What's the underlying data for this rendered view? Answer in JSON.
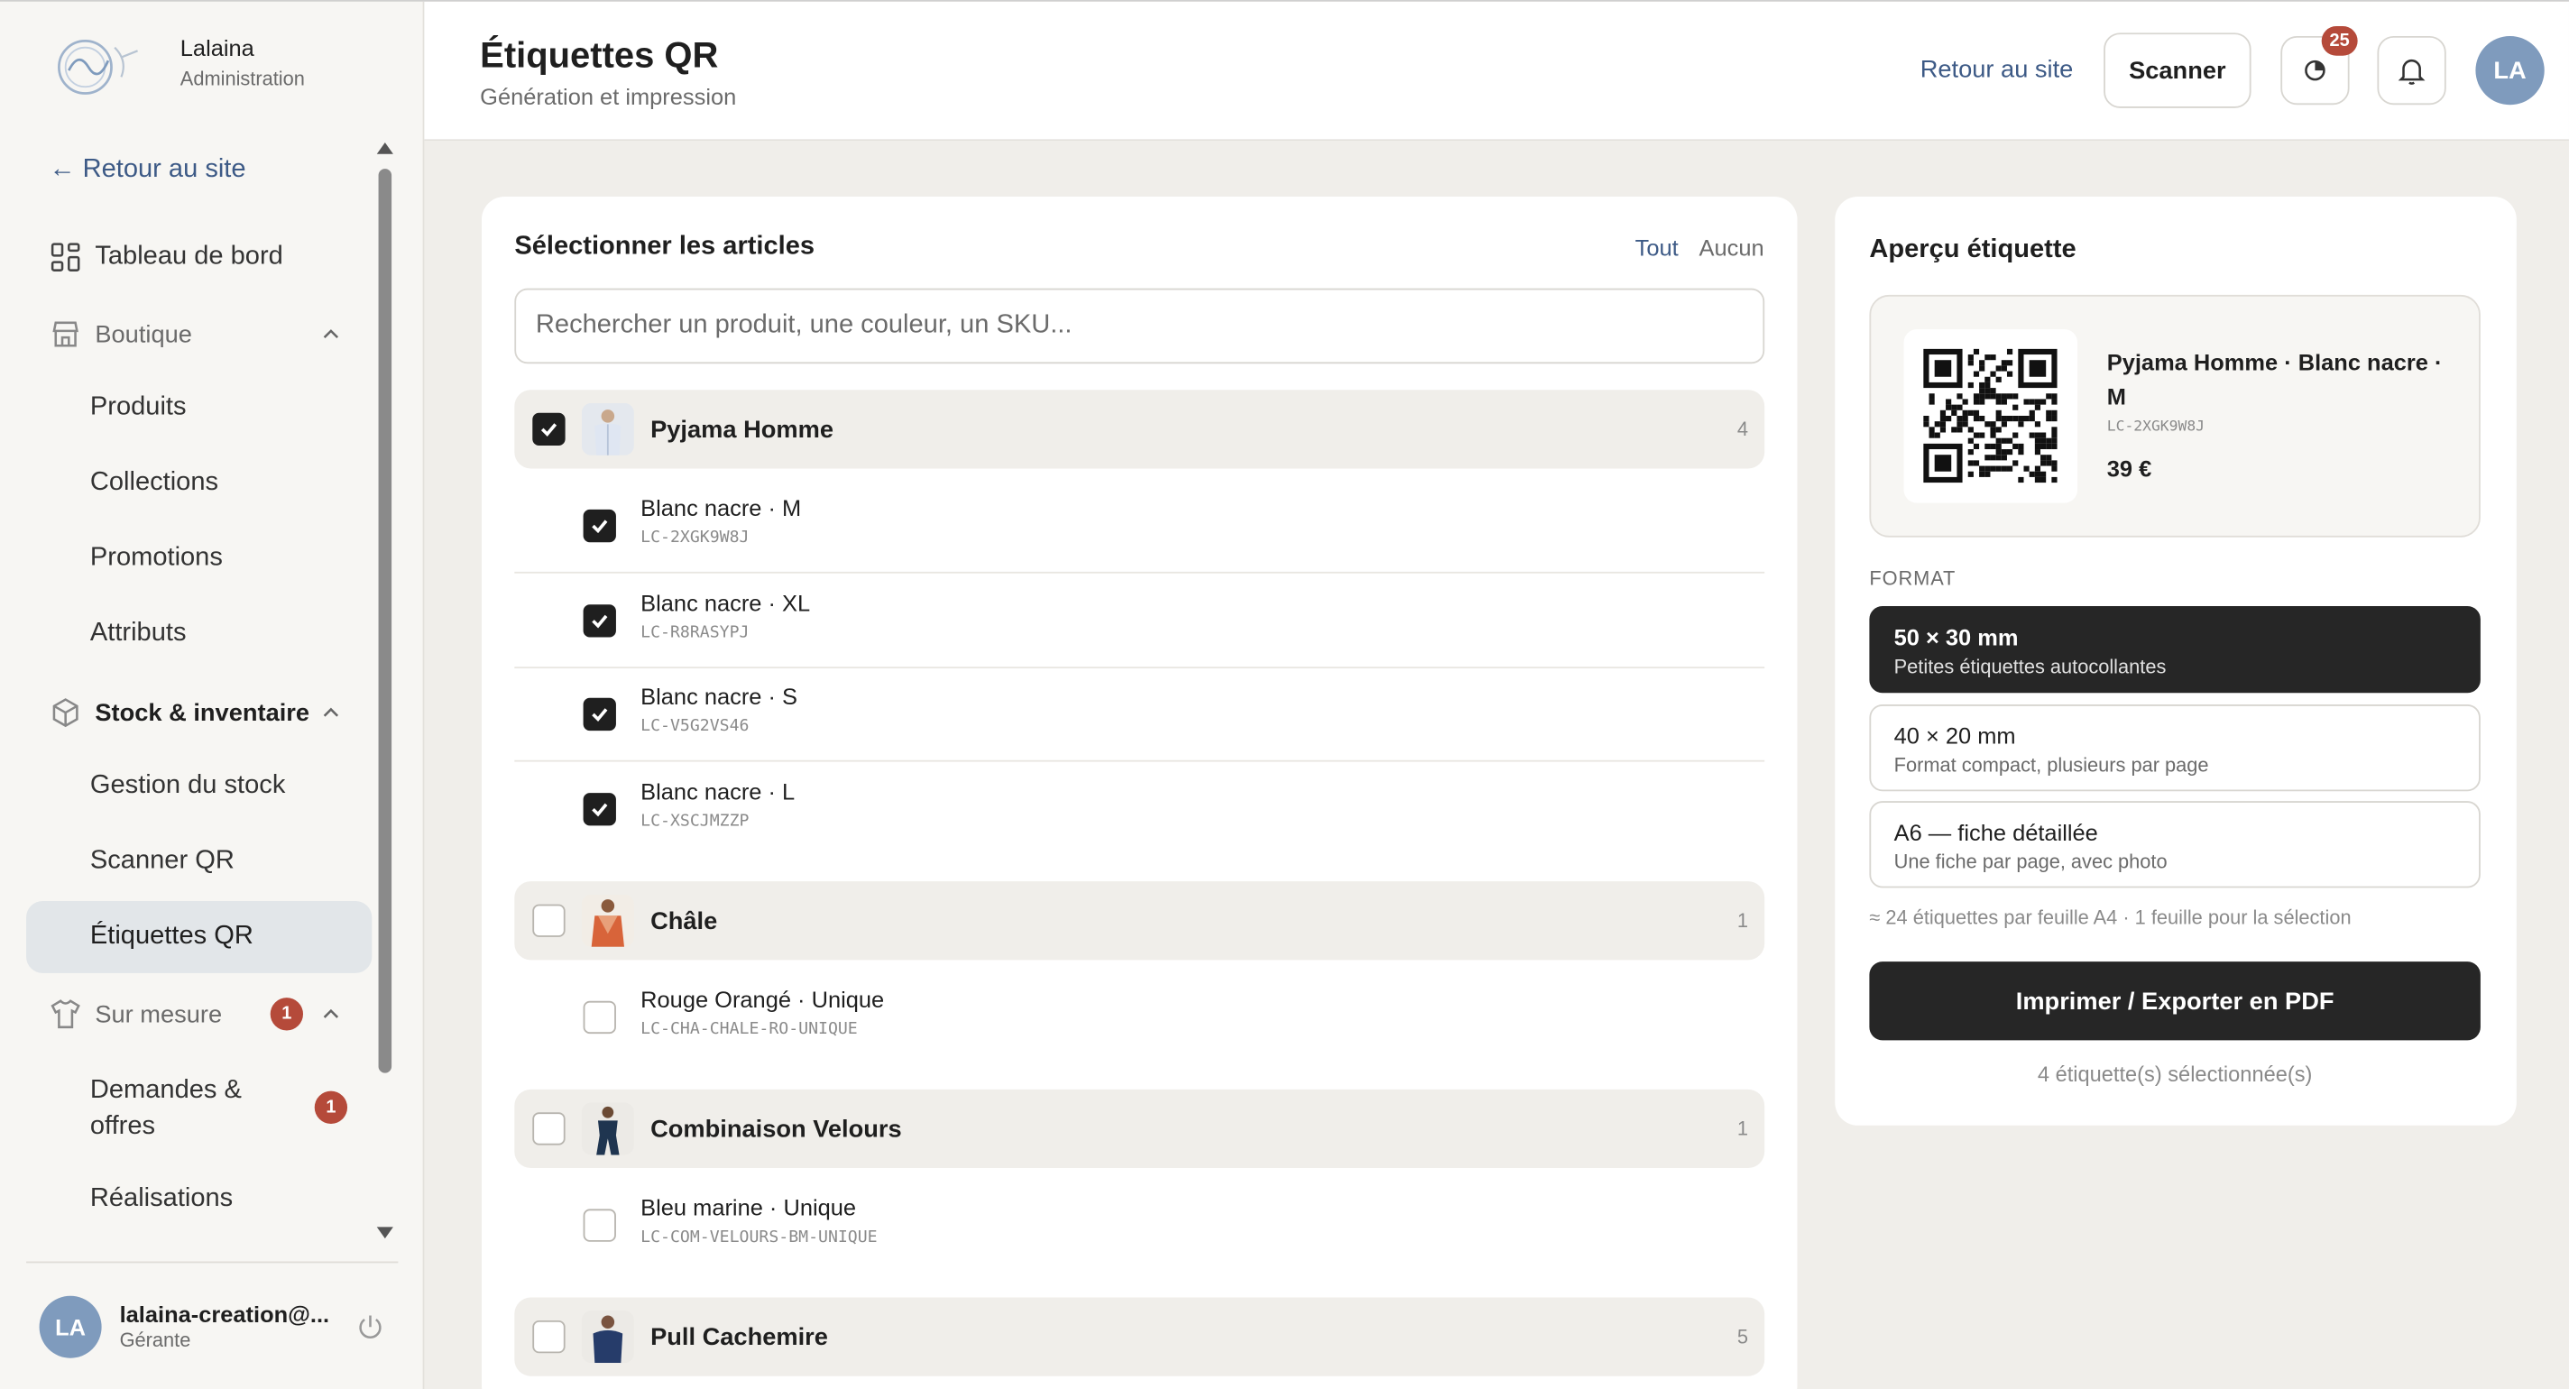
{
  "brand": {
    "name": "Lalaina",
    "subtitle": "Administration"
  },
  "sidebar": {
    "back_link": "← Retour au site",
    "dashboard": "Tableau de bord",
    "boutique": {
      "label": "Boutique",
      "items": [
        "Produits",
        "Collections",
        "Promotions",
        "Attributs"
      ]
    },
    "stock": {
      "label": "Stock & inventaire",
      "items": [
        "Gestion du stock",
        "Scanner QR",
        "Étiquettes QR"
      ]
    },
    "sur_mesure": {
      "label": "Sur mesure",
      "badge": "1",
      "items": [
        {
          "label": "Demandes & offres",
          "badge": "1"
        },
        {
          "label": "Réalisations"
        }
      ]
    },
    "active_item": "Étiquettes QR",
    "user": {
      "initials": "LA",
      "email": "lalaina-creation@...",
      "role": "Gérante"
    }
  },
  "header": {
    "title": "Étiquettes QR",
    "subtitle": "Génération et impression",
    "back_link": "Retour au site",
    "scan_button": "Scanner",
    "activity_badge": "25",
    "avatar_initials": "LA"
  },
  "selection": {
    "title": "Sélectionner les articles",
    "select_all": "Tout",
    "select_none": "Aucun",
    "search_placeholder": "Rechercher un produit, une couleur, un SKU...",
    "products": [
      {
        "name": "Pyjama Homme",
        "count": "4",
        "checked": true,
        "variants": [
          {
            "name": "Blanc nacre · M",
            "sku": "LC-2XGK9W8J",
            "checked": true
          },
          {
            "name": "Blanc nacre · XL",
            "sku": "LC-R8RASYPJ",
            "checked": true
          },
          {
            "name": "Blanc nacre · S",
            "sku": "LC-V5G2VS46",
            "checked": true
          },
          {
            "name": "Blanc nacre · L",
            "sku": "LC-XSCJMZZP",
            "checked": true
          }
        ]
      },
      {
        "name": "Châle",
        "count": "1",
        "checked": false,
        "variants": [
          {
            "name": "Rouge Orangé · Unique",
            "sku": "LC-CHA-CHALE-RO-UNIQUE",
            "checked": false
          }
        ]
      },
      {
        "name": "Combinaison Velours",
        "count": "1",
        "checked": false,
        "variants": [
          {
            "name": "Bleu marine · Unique",
            "sku": "LC-COM-VELOURS-BM-UNIQUE",
            "checked": false
          }
        ]
      },
      {
        "name": "Pull Cachemire",
        "count": "5",
        "checked": false,
        "variants": []
      }
    ]
  },
  "preview": {
    "title": "Aperçu étiquette",
    "label_name": "Pyjama Homme · Blanc nacre · M",
    "label_sku": "LC-2XGK9W8J",
    "label_price": "39 €",
    "format_label": "FORMAT",
    "formats": [
      {
        "title": "50 × 30 mm",
        "desc": "Petites étiquettes autocollantes",
        "selected": true
      },
      {
        "title": "40 × 20 mm",
        "desc": "Format compact, plusieurs par page",
        "selected": false
      },
      {
        "title": "A6 — fiche détaillée",
        "desc": "Une fiche par page, avec photo",
        "selected": false
      }
    ],
    "note": "≈ 24 étiquettes par feuille A4 · 1 feuille pour la sélection",
    "print_button": "Imprimer / Exporter en PDF",
    "selected_count": "4 étiquette(s) sélectionnée(s)"
  },
  "colors": {
    "accent": "#3d5a86",
    "dark": "#262626",
    "badge": "#b54a3a",
    "avatar": "#7f9bbd",
    "background": "#f0eeea"
  }
}
